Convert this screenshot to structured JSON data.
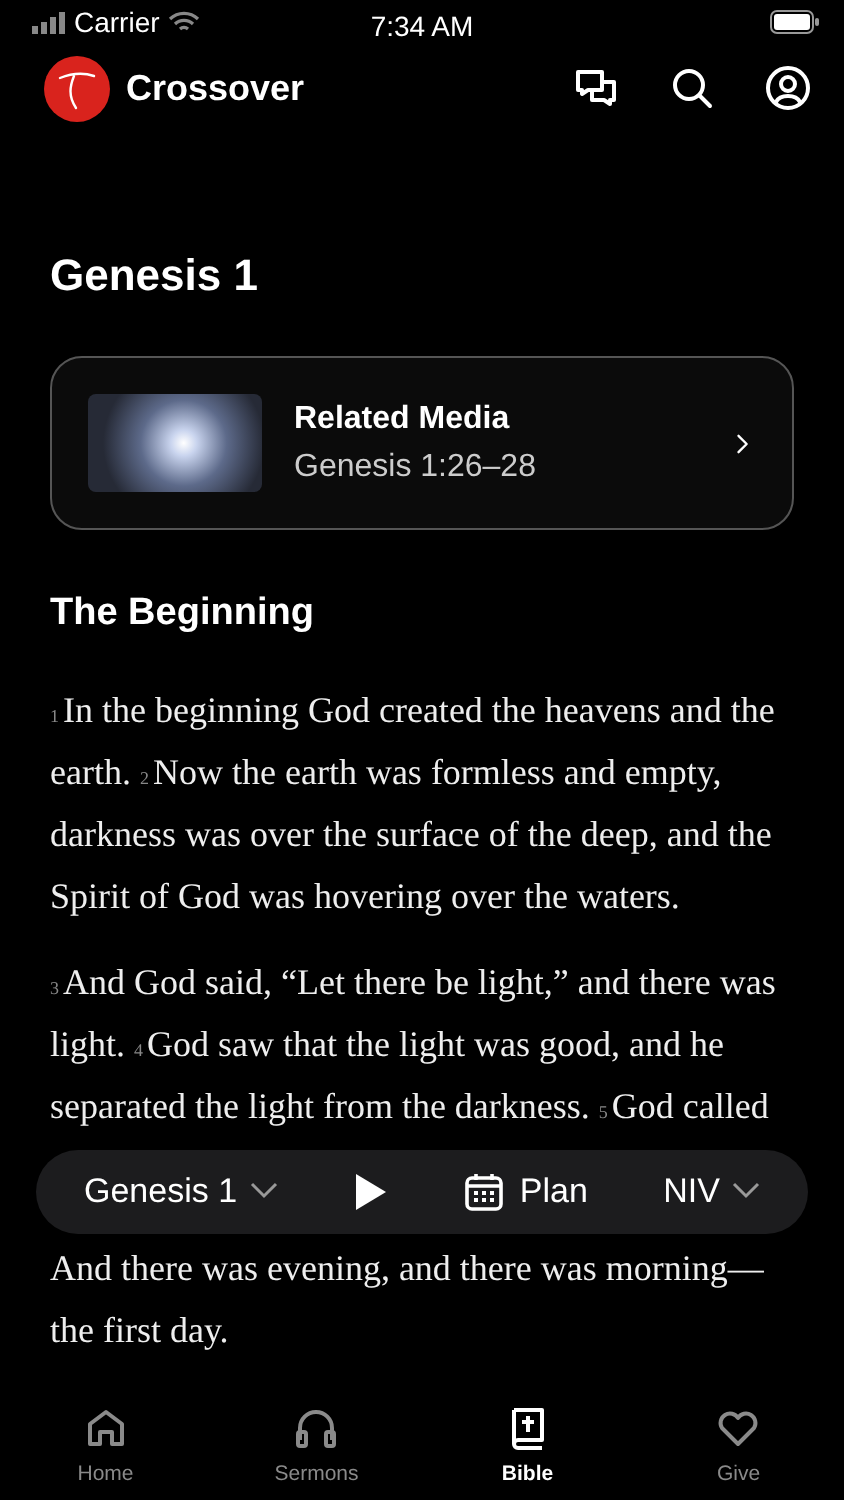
{
  "status_bar": {
    "carrier": "Carrier",
    "time": "7:34 AM"
  },
  "header": {
    "app_name": "Crossover"
  },
  "title": "Genesis 1",
  "related_media": {
    "title": "Related Media",
    "reference": "Genesis 1:26–28"
  },
  "section_heading": "The Beginning",
  "paragraphs": [
    {
      "verses": [
        {
          "number": "1",
          "text": "In the beginning God created the heavens and the earth."
        },
        {
          "number": "2",
          "text": "Now the earth was formless and empty, darkness was over the surface of the deep, and the Spirit of God was hovering over the waters."
        }
      ]
    },
    {
      "verses": [
        {
          "number": "3",
          "text": "And God said, “Let there be light,” and there was light."
        },
        {
          "number": "4",
          "text": "God saw that the light was good, and he separated the light from the darkness."
        },
        {
          "number": "5",
          "text": "God called"
        }
      ]
    }
  ],
  "continuation": "And there was evening, and there was morning—the first day.",
  "player_bar": {
    "chapter": "Genesis 1",
    "plan": "Plan",
    "version": "NIV"
  },
  "tabs": [
    {
      "label": "Home",
      "selected": false
    },
    {
      "label": "Sermons",
      "selected": false
    },
    {
      "label": "Bible",
      "selected": true
    },
    {
      "label": "Give",
      "selected": false
    }
  ]
}
